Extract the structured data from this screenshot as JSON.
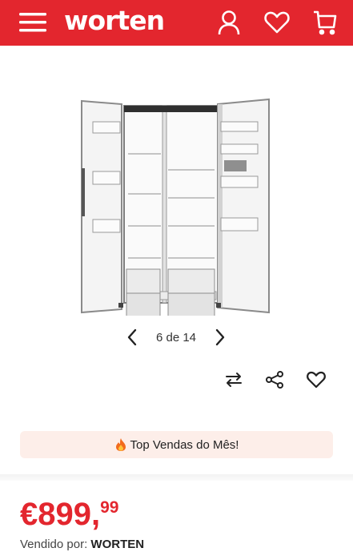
{
  "header": {
    "logo": "worten",
    "icons": [
      "menu-icon",
      "user-icon",
      "heart-icon",
      "cart-icon"
    ],
    "background": "#e3262e"
  },
  "gallery": {
    "image": "side-by-side-refrigerator",
    "pager_text": "6 de 14"
  },
  "actions": [
    "compare-icon",
    "share-icon",
    "heart-icon"
  ],
  "promo": {
    "text": "Top Vendas do Mês!",
    "icon": "fire-icon"
  },
  "price": {
    "main": "€899,",
    "cents": "99",
    "color": "#e3262e"
  },
  "seller": {
    "label": "Vendido por:",
    "name": "WORTEN"
  }
}
